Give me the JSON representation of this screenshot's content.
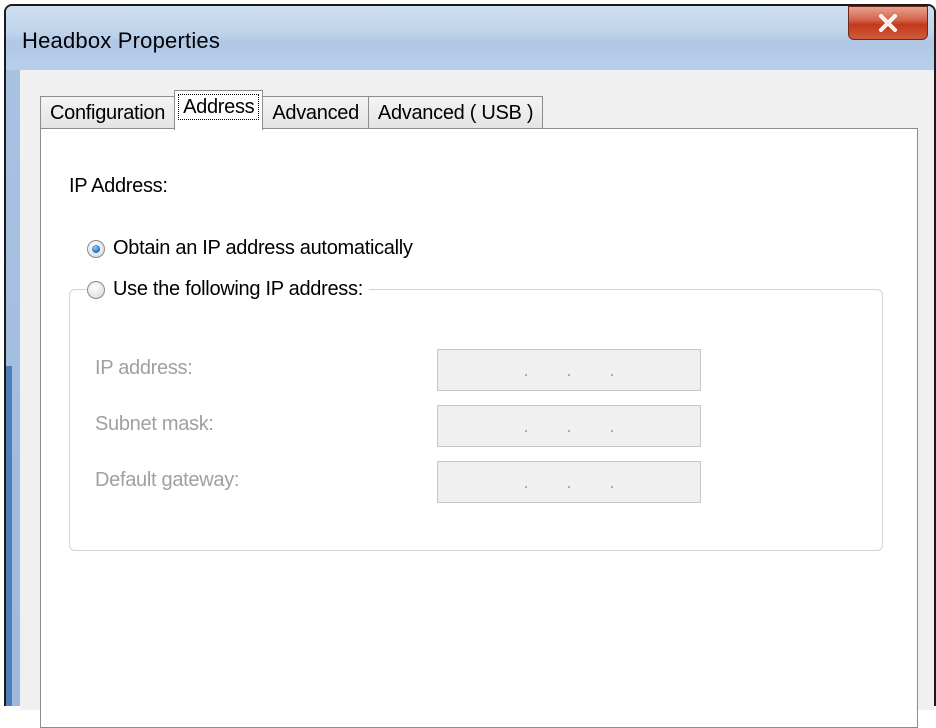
{
  "window": {
    "title": "Headbox Properties"
  },
  "tabs": [
    {
      "label": "Configuration",
      "active": false
    },
    {
      "label": "Address",
      "active": true
    },
    {
      "label": "Advanced",
      "active": false
    },
    {
      "label": "Advanced ( USB )",
      "active": false
    }
  ],
  "address_panel": {
    "section_label": "IP Address:",
    "option_auto": {
      "label": "Obtain an IP address automatically",
      "checked": true
    },
    "option_manual": {
      "label": "Use the following IP address:",
      "checked": false
    },
    "fields": [
      {
        "label": "IP address:",
        "value": ". . ."
      },
      {
        "label": "Subnet mask:",
        "value": ". . ."
      },
      {
        "label": "Default gateway:",
        "value": ". . ."
      }
    ]
  },
  "icons": {
    "close": "close-icon"
  },
  "colors": {
    "disabled_text": "#a0a0a0",
    "close_button": "#c2391b",
    "radio_selected": "#2b7fcf"
  }
}
